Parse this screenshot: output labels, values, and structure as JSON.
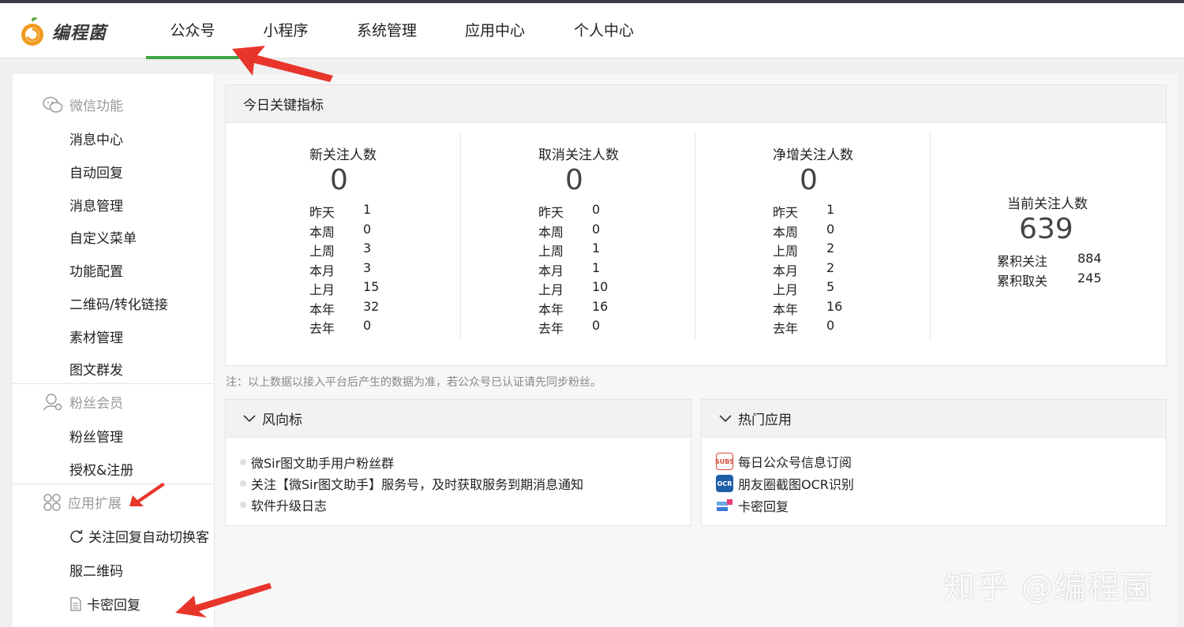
{
  "brand": {
    "name": "编程菌"
  },
  "nav": {
    "tabs": [
      {
        "label": "公众号",
        "active": true
      },
      {
        "label": "小程序"
      },
      {
        "label": "系统管理"
      },
      {
        "label": "应用中心"
      },
      {
        "label": "个人中心"
      }
    ]
  },
  "sidebar": {
    "groups": [
      {
        "title": "微信功能",
        "items": [
          "消息中心",
          "自动回复",
          "消息管理",
          "自定义菜单",
          "功能配置",
          "二维码/转化链接",
          "素材管理",
          "图文群发"
        ]
      },
      {
        "title": "粉丝会员",
        "items": [
          "粉丝管理",
          "授权&注册"
        ]
      },
      {
        "title": "应用扩展",
        "items": [
          "关注回复自动切换客",
          "服二维码",
          "卡密回复"
        ]
      }
    ]
  },
  "kpi": {
    "title": "今日关键指标",
    "columns": [
      {
        "title": "新关注人数",
        "value": "0",
        "rows": [
          [
            "昨天",
            "1"
          ],
          [
            "本周",
            "0"
          ],
          [
            "上周",
            "3"
          ],
          [
            "本月",
            "3"
          ],
          [
            "上月",
            "15"
          ],
          [
            "本年",
            "32"
          ],
          [
            "去年",
            "0"
          ]
        ]
      },
      {
        "title": "取消关注人数",
        "value": "0",
        "rows": [
          [
            "昨天",
            "0"
          ],
          [
            "本周",
            "0"
          ],
          [
            "上周",
            "1"
          ],
          [
            "本月",
            "1"
          ],
          [
            "上月",
            "10"
          ],
          [
            "本年",
            "16"
          ],
          [
            "去年",
            "0"
          ]
        ]
      },
      {
        "title": "净增关注人数",
        "value": "0",
        "rows": [
          [
            "昨天",
            "1"
          ],
          [
            "本周",
            "0"
          ],
          [
            "上周",
            "2"
          ],
          [
            "本月",
            "2"
          ],
          [
            "上月",
            "5"
          ],
          [
            "本年",
            "16"
          ],
          [
            "去年",
            "0"
          ]
        ]
      }
    ],
    "current": {
      "title": "当前关注人数",
      "value": "639",
      "rows": [
        [
          "累积关注",
          "884"
        ],
        [
          "累积取关",
          "245"
        ]
      ]
    }
  },
  "note": "注：以上数据以接入平台后产生的数据为准，若公众号已认证请先同步粉丝。",
  "vane": {
    "title": "风向标",
    "items": [
      "微Sir图文助手用户粉丝群",
      "关注【微Sir图文助手】服务号，及时获取服务到期消息通知",
      "软件升级日志"
    ]
  },
  "hot": {
    "title": "热门应用",
    "items": [
      {
        "label": "每日公众号信息订阅",
        "icon": "subscribe-icon",
        "icon_text": "SUBS"
      },
      {
        "label": "朋友圈截图OCR识别",
        "icon": "ocr-icon",
        "icon_text": "OCR"
      },
      {
        "label": "卡密回复",
        "icon": "card-icon"
      }
    ]
  },
  "watermark": "知乎 @编程菌",
  "colors": {
    "accent": "#3ea744",
    "arrow": "#e8352b",
    "topstrip": "#3a3f45"
  }
}
